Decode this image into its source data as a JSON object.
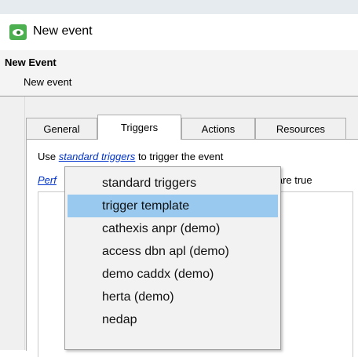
{
  "window": {
    "title": "New event"
  },
  "header": {
    "title": "New Event",
    "subtitle": "New event"
  },
  "tabs": [
    {
      "label": "General"
    },
    {
      "label": "Triggers"
    },
    {
      "label": "Actions"
    },
    {
      "label": "Resources"
    }
  ],
  "active_tab": "Triggers",
  "triggers_panel": {
    "line1_prefix": "Use",
    "line1_link": "standard triggers",
    "line1_suffix": "to trigger the event",
    "line2_link": "Perf",
    "line2_tail": "g are true"
  },
  "dropdown": {
    "highlighted_index": 1,
    "items": [
      {
        "label": "standard triggers"
      },
      {
        "label": "trigger template"
      },
      {
        "label": "cathexis anpr (demo)"
      },
      {
        "label": "access dbn apl (demo)"
      },
      {
        "label": "demo caddx (demo)"
      },
      {
        "label": "herta (demo)"
      },
      {
        "label": "nedap"
      }
    ]
  },
  "colors": {
    "app_icon": "#4caf50",
    "link": "#0033cc",
    "menu_highlight": "#99c9ef"
  }
}
